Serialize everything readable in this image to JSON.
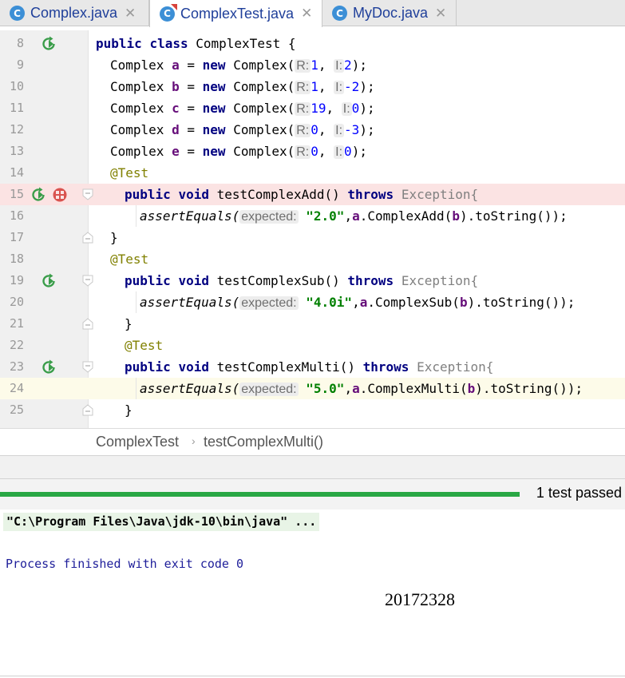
{
  "tabs": [
    {
      "label": "Complex.java",
      "icon": "C",
      "active": false
    },
    {
      "label": "ComplexTest.java",
      "icon": "C",
      "active": true
    },
    {
      "label": "MyDoc.java",
      "icon": "C",
      "active": false
    }
  ],
  "editor": {
    "lines": [
      {
        "num": "8",
        "kind": "class",
        "t1": "public",
        "t2": "class",
        "t3": "ComplexTest {"
      },
      {
        "num": "9",
        "kind": "decl",
        "type": "Complex",
        "var": "a",
        "eq": "=",
        "kw": "new",
        "ctor": "Complex(",
        "r": "R:",
        "rv": "1",
        "i": "I:",
        "iv": "2",
        "end": ");"
      },
      {
        "num": "10",
        "kind": "decl",
        "type": "Complex",
        "var": "b",
        "eq": "=",
        "kw": "new",
        "ctor": "Complex(",
        "r": "R:",
        "rv": "1",
        "i": "I:",
        "iv": "-2",
        "end": ");"
      },
      {
        "num": "11",
        "kind": "decl",
        "type": "Complex",
        "var": "c",
        "eq": "=",
        "kw": "new",
        "ctor": "Complex(",
        "r": "R:",
        "rv": "19",
        "i": "I:",
        "iv": "0",
        "end": ");"
      },
      {
        "num": "12",
        "kind": "decl",
        "type": "Complex",
        "var": "d",
        "eq": "=",
        "kw": "new",
        "ctor": "Complex(",
        "r": "R:",
        "rv": "0",
        "i": "I:",
        "iv": "-3",
        "end": ");"
      },
      {
        "num": "13",
        "kind": "decl",
        "type": "Complex",
        "var": "e",
        "eq": "=",
        "kw": "new",
        "ctor": "Complex(",
        "r": "R:",
        "rv": "0",
        "i": "I:",
        "iv": "0",
        "end": ");"
      },
      {
        "num": "14",
        "kind": "ann",
        "text": "@Test"
      },
      {
        "num": "15",
        "kind": "method",
        "t1": "public",
        "t2": "void",
        "name": "testComplexAdd()",
        "throws": "throws",
        "exc": "Exception{"
      },
      {
        "num": "16",
        "kind": "assert",
        "fn": "assertEquals(",
        "hint": "expected:",
        "str": "\"2.0\"",
        "comma": ",",
        "obj": "a",
        "call": ".ComplexAdd(",
        "arg": "b",
        "rest": ").toString());"
      },
      {
        "num": "17",
        "kind": "brace",
        "text": "}"
      },
      {
        "num": "18",
        "kind": "ann",
        "text": "@Test"
      },
      {
        "num": "19",
        "kind": "method",
        "t1": "public",
        "t2": "void",
        "name": "testComplexSub()",
        "throws": "throws",
        "exc": "Exception{"
      },
      {
        "num": "20",
        "kind": "assert",
        "fn": "assertEquals(",
        "hint": "expected:",
        "str": "\"4.0i\"",
        "comma": ",",
        "obj": "a",
        "call": ".ComplexSub(",
        "arg": "b",
        "rest": ").toString());"
      },
      {
        "num": "21",
        "kind": "brace",
        "text": "}"
      },
      {
        "num": "22",
        "kind": "ann",
        "text": "@Test"
      },
      {
        "num": "23",
        "kind": "method",
        "t1": "public",
        "t2": "void",
        "name": "testComplexMulti()",
        "throws": "throws",
        "exc": "Exception{"
      },
      {
        "num": "24",
        "kind": "assert",
        "fn": "assertEquals(",
        "hint": "expected:",
        "str": "\"5.0\"",
        "comma": ",",
        "obj": "a",
        "call": ".ComplexMulti(",
        "arg": "b",
        "rest": ").toString());"
      },
      {
        "num": "25",
        "kind": "brace",
        "text": "}"
      }
    ]
  },
  "breadcrumb": {
    "class": "ComplexTest",
    "sep": "›",
    "method": "testComplexMulti()"
  },
  "test_run": {
    "status": "1 test passed",
    "progress": 1.0,
    "color": "#29a744"
  },
  "console": {
    "command": "\"C:\\Program Files\\Java\\jdk-10\\bin\\java\" ...",
    "process": "Process finished with exit code 0",
    "student_id": "20172328"
  },
  "colors": {
    "keyword": "#000080",
    "field": "#660e7a",
    "annotation": "#808000",
    "string": "#008000",
    "error_line": "#fbe3e3",
    "current_line": "#fdfbe9"
  }
}
